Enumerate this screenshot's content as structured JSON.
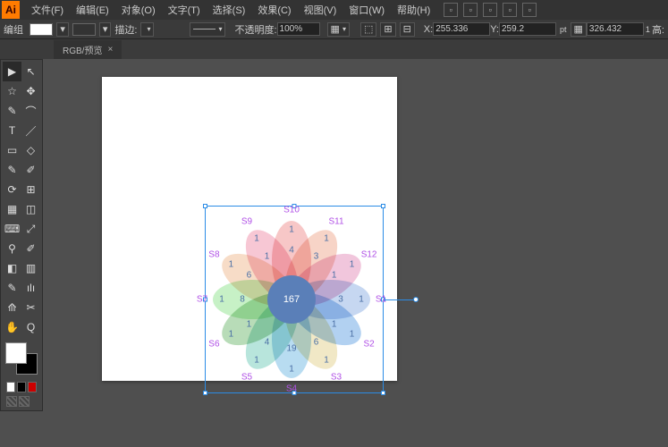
{
  "app": {
    "icon_text": "Ai"
  },
  "menu": {
    "items": [
      "文件(F)",
      "编辑(E)",
      "对象(O)",
      "文字(T)",
      "选择(S)",
      "效果(C)",
      "视图(V)",
      "窗口(W)",
      "帮助(H)"
    ]
  },
  "toolbar_right_icons": [
    "menu",
    "layout",
    "st",
    "brush",
    "go"
  ],
  "controlbar": {
    "label": "编组",
    "stroke_menu": "▾",
    "swap_icon": "⇄",
    "descr": "描边:",
    "opacity_label": "不透明度:",
    "opacity_value": "100%",
    "align_icons": [
      "⬚",
      "⊞",
      "⊟"
    ],
    "xlabel": "X:",
    "xvalue": "255.336",
    "ylabel": "Y:",
    "259": "259.2",
    "yunit": "pt",
    "extra_icon": "▦",
    "wvalue": "326.432",
    "hunit": "1",
    "hlabel": "高:"
  },
  "doc_tab": {
    "name": "RGB/预览",
    "close": "×"
  },
  "tools": {
    "rows": [
      [
        "▶",
        "↖"
      ],
      [
        "☆",
        "✥"
      ],
      [
        "✎",
        "⌒"
      ],
      [
        "T",
        "／"
      ],
      [
        "▭",
        "◇"
      ],
      [
        "✎",
        "✐"
      ],
      [
        "⟳",
        "⊞"
      ],
      [
        "▦",
        "◫"
      ],
      [
        "⌨",
        "⤢"
      ],
      [
        "⚲",
        "✐"
      ],
      [
        "◧",
        "▥"
      ],
      [
        "✎",
        "ılı"
      ],
      [
        "⟰",
        "✂"
      ],
      [
        "✋",
        "Q"
      ]
    ]
  },
  "chart_data": {
    "type": "venn-flower",
    "center_value": 167,
    "petals": [
      {
        "label": "S10",
        "angle": 0,
        "inner": 4,
        "middle": 1,
        "color": "#f2a1a1"
      },
      {
        "label": "S11",
        "angle": 30,
        "inner": 3,
        "middle": 1,
        "color": "#f2b8a1"
      },
      {
        "label": "S12",
        "angle": 60,
        "inner": 1,
        "middle": 1,
        "color": "#e89fc4"
      },
      {
        "label": "S1",
        "angle": 90,
        "inner": 3,
        "middle": 1,
        "color": "#9fbce8"
      },
      {
        "label": "S2",
        "angle": 120,
        "inner": 1,
        "middle": 1,
        "color": "#7fb3e8"
      },
      {
        "label": "S3",
        "angle": 150,
        "inner": 6,
        "middle": 1,
        "color": "#e8d89f"
      },
      {
        "label": "S4",
        "angle": 180,
        "inner": 19,
        "middle": 1,
        "color": "#89c4e8"
      },
      {
        "label": "S5",
        "angle": 210,
        "inner": 4,
        "middle": 1,
        "color": "#89d4c4"
      },
      {
        "label": "S6",
        "angle": 240,
        "inner": 1,
        "middle": 1,
        "color": "#89c489"
      },
      {
        "label": "S7",
        "angle": 270,
        "inner": 8,
        "middle": 1,
        "color": "#a1e89f"
      },
      {
        "label": "S8",
        "angle": 300,
        "inner": 6,
        "middle": 1,
        "color": "#f2c4a1"
      },
      {
        "label": "S9",
        "angle": 330,
        "inner": 1,
        "middle": 1,
        "color": "#f2a1b8"
      }
    ]
  }
}
